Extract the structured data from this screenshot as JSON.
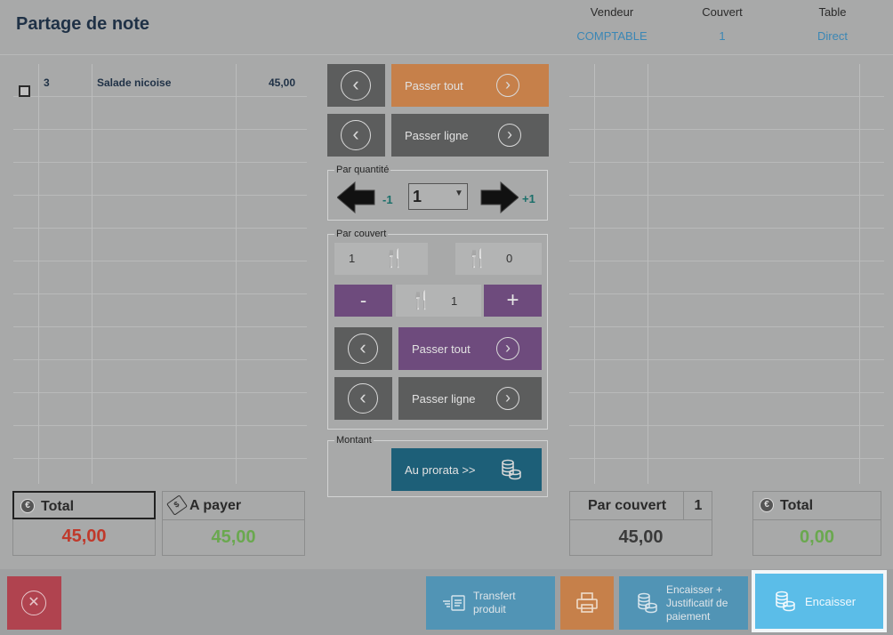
{
  "header": {
    "title": "Partage de note",
    "columns": [
      {
        "label": "Vendeur",
        "value": "COMPTABLE"
      },
      {
        "label": "Couvert",
        "value": "1"
      },
      {
        "label": "Table",
        "value": "Direct"
      }
    ]
  },
  "left_table": {
    "rows": [
      {
        "qty": "3",
        "name": "Salade nicoise",
        "price": "45,00",
        "checked": false
      }
    ]
  },
  "middle": {
    "pass_all_label": "Passer tout",
    "pass_line_label": "Passer ligne",
    "par_quantite": {
      "legend": "Par quantité",
      "minus_label": "-1",
      "plus_label": "+1",
      "selected_qty": "1"
    },
    "par_couvert": {
      "legend": "Par couvert",
      "left_count": "1",
      "right_count": "0",
      "minus_label": "-",
      "plus_label": "+",
      "stepper_value": "1",
      "pass_all_label": "Passer tout",
      "pass_line_label": "Passer ligne"
    },
    "montant": {
      "legend": "Montant",
      "prorata_label": "Au prorata >>"
    }
  },
  "totals_left": {
    "total_label": "Total",
    "total_value": "45,00",
    "apayer_label": "A payer",
    "apayer_value": "45,00"
  },
  "totals_right": {
    "par_couvert_label": "Par couvert",
    "par_couvert_count": "1",
    "par_couvert_value": "45,00",
    "total_label": "Total",
    "total_value": "0,00"
  },
  "footer": {
    "transfert_label": "Transfert produit",
    "encaisser_justif_label": "Encaisser + Justificatif de paiement",
    "encaisser_label": "Encaisser"
  },
  "colors": {
    "background": "#a8a9a9",
    "orange": "#c6804a",
    "purple": "#6e4b7d",
    "teal": "#1d5f78",
    "red_total": "#c0392b",
    "green_value": "#6aa84f",
    "encaisser_blue": "#5bbde8"
  }
}
